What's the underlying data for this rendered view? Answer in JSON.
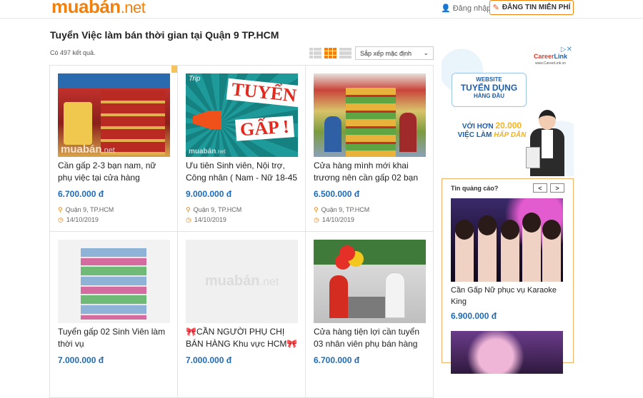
{
  "header": {
    "logo_main": "muabán",
    "logo_suffix": ".net",
    "login_label": "Đăng nhập",
    "post_button_label": "ĐĂNG TIN MIỄN PHÍ"
  },
  "page": {
    "title": "Tuyển Việc làm bán thời gian tại Quận 9 TP.HCM",
    "result_count": "Có 497 kết quả.",
    "sort_label": "Sắp xếp mặc định",
    "view_modes": [
      "list",
      "grid",
      "compact-list"
    ],
    "active_view": "grid"
  },
  "listings": [
    {
      "title": "Cần gấp 2-3 bạn nam, nữ phụ việc tại cửa hàng",
      "price": "6.700.000 đ",
      "location": "Quận 9, TP.HCM",
      "date": "14/10/2019",
      "watermark": "muabán",
      "watermark_suffix": ".net"
    },
    {
      "title": "Ưu tiên Sinh viên, Nội trợ, Công nhân ( Nam - Nữ 18-45",
      "price": "9.000.000 đ",
      "location": "Quận 9, TP.HCM",
      "date": "14/10/2019",
      "img_text_1": "TUYỂN",
      "img_text_2": "GẤP !",
      "img_brand": "Trip",
      "watermark": "muabán",
      "watermark_suffix": ".net"
    },
    {
      "title": "Cửa hàng mình mới khai trương nên cần gấp 02 bạn",
      "price": "6.500.000 đ",
      "location": "Quận 9, TP.HCM",
      "date": "14/10/2019"
    },
    {
      "title": "Tuyển gấp 02 Sinh Viên làm thời vụ",
      "price": "7.000.000 đ"
    },
    {
      "title": "🎀CẦN NGƯỜI PHỤ CHỊ BÁN HÀNG Khu vực HCM🎀",
      "price": "7.000.000 đ",
      "placeholder_logo": "muabán",
      "placeholder_suffix": ".net"
    },
    {
      "title": "Cửa hàng tiện lợi cần tuyển 03 nhân viên phụ bán hàng",
      "price": "6.700.000 đ"
    }
  ],
  "sidebar": {
    "banner": {
      "brand_line1": "Career",
      "brand_line2": "Link",
      "brand_url": "www.CareerLink.vn",
      "box_line1": "WEBSITE",
      "box_line2": "TUYỂN DỤNG",
      "box_line3": "HÀNG ĐẦU",
      "offer_prefix": "VỚI HƠN",
      "offer_number": "20.000",
      "offer_text": "VIỆC LÀM",
      "offer_highlight": "HẤP DẪN",
      "close_icon": "close-icon"
    },
    "ad_box": {
      "heading": "Tin quảng cáo?",
      "prev_symbol": "<",
      "next_symbol": ">",
      "item_title": "Cần Gấp Nữ phục vụ Karaoke King",
      "item_price": "6.900.000 đ"
    }
  },
  "colors": {
    "brand_orange": "#f0810f",
    "price_blue": "#1e6bb8"
  }
}
